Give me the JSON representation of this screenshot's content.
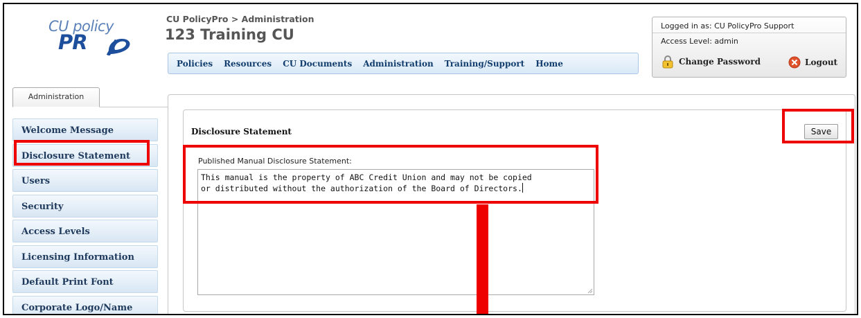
{
  "logo": {
    "line1": "CU policy",
    "line2": "PR"
  },
  "header": {
    "breadcrumb": "CU PolicyPro > Administration",
    "title": "123 Training CU"
  },
  "nav": {
    "items": [
      {
        "label": "Policies"
      },
      {
        "label": "Resources"
      },
      {
        "label": "CU Documents"
      },
      {
        "label": "Administration"
      },
      {
        "label": "Training/Support"
      },
      {
        "label": "Home"
      }
    ]
  },
  "user": {
    "logged_in": "Logged in as: CU PolicyPro Support",
    "access_level": "Access Level: admin",
    "change_password": "Change Password",
    "logout": "Logout"
  },
  "tab": {
    "label": "Administration"
  },
  "sidebar": {
    "items": [
      {
        "label": "Welcome Message"
      },
      {
        "label": "Disclosure Statement"
      },
      {
        "label": "Users"
      },
      {
        "label": "Security"
      },
      {
        "label": "Access Levels"
      },
      {
        "label": "Licensing Information"
      },
      {
        "label": "Default Print Font"
      },
      {
        "label": "Corporate Logo/Name"
      }
    ]
  },
  "main": {
    "section_title": "Disclosure Statement",
    "save_label": "Save",
    "field_label": "Published Manual Disclosure Statement:",
    "field_value": "This manual is the property of ABC Credit Union and may not be copied\nor distributed without the authorization of the Board of Directors."
  },
  "colors": {
    "annotation": "#ee0000",
    "nav_text": "#123d6d",
    "sidebar_text": "#1f3a5c",
    "logo_blue": "#1e4f9c"
  }
}
